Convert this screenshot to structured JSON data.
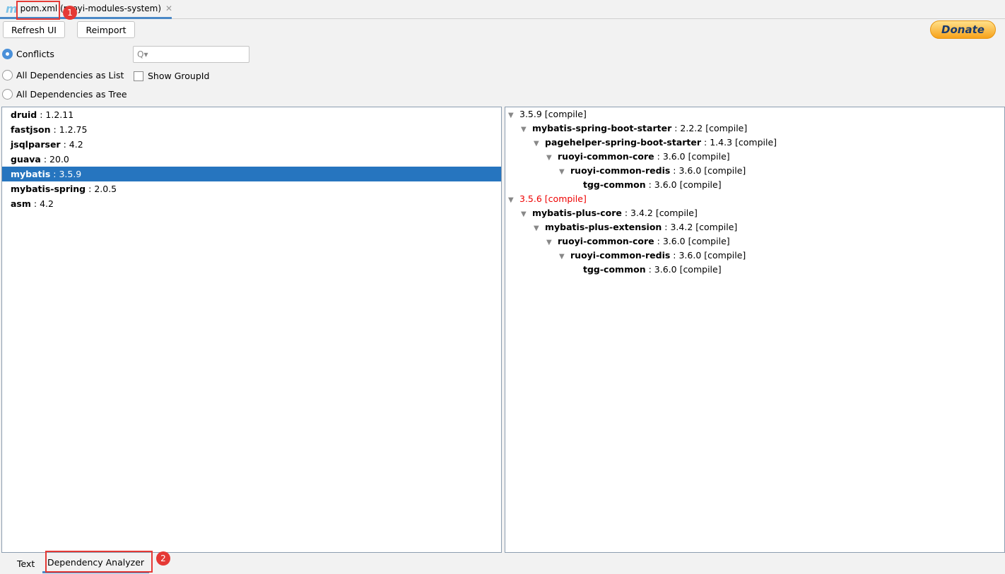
{
  "editor_tab": {
    "icon": "maven-icon",
    "icon_glyph": "m",
    "file": "pom.xml",
    "module": "(ruoyi-modules-system)"
  },
  "annotations": {
    "badge1": "1",
    "badge2": "2"
  },
  "toolbar": {
    "refresh": "Refresh UI",
    "reimport": "Reimport",
    "donate": "Donate"
  },
  "modes": [
    {
      "label": "Conflicts",
      "selected": true
    },
    {
      "label": "All Dependencies as List",
      "selected": false
    },
    {
      "label": "All Dependencies as Tree",
      "selected": false
    }
  ],
  "search": {
    "placeholder": "Q▾",
    "value": ""
  },
  "show_group_id": {
    "label": "Show GroupId",
    "checked": false
  },
  "conflicts": [
    {
      "name": "druid",
      "version": "1.2.11"
    },
    {
      "name": "fastjson",
      "version": "1.2.75"
    },
    {
      "name": "jsqlparser",
      "version": "4.2"
    },
    {
      "name": "guava",
      "version": "20.0"
    },
    {
      "name": "mybatis",
      "version": "3.5.9",
      "selected": true
    },
    {
      "name": "mybatis-spring",
      "version": "2.0.5"
    },
    {
      "name": "asm",
      "version": "4.2"
    }
  ],
  "tree": [
    {
      "level": 0,
      "name": "",
      "version": "3.5.9",
      "scope": "[compile]",
      "expanded": true,
      "conflict": false
    },
    {
      "level": 1,
      "name": "mybatis-spring-boot-starter",
      "version": "2.2.2",
      "scope": "[compile]",
      "expanded": true
    },
    {
      "level": 2,
      "name": "pagehelper-spring-boot-starter",
      "version": "1.4.3",
      "scope": "[compile]",
      "expanded": true
    },
    {
      "level": 3,
      "name": "ruoyi-common-core",
      "version": "3.6.0",
      "scope": "[compile]",
      "expanded": true
    },
    {
      "level": 4,
      "name": "ruoyi-common-redis",
      "version": "3.6.0",
      "scope": "[compile]",
      "expanded": true
    },
    {
      "level": 5,
      "name": "tgg-common",
      "version": "3.6.0",
      "scope": "[compile]",
      "leaf": true
    },
    {
      "level": 0,
      "name": "",
      "version": "3.5.6",
      "scope": "[compile]",
      "expanded": true,
      "conflict": true
    },
    {
      "level": 1,
      "name": "mybatis-plus-core",
      "version": "3.4.2",
      "scope": "[compile]",
      "expanded": true
    },
    {
      "level": 2,
      "name": "mybatis-plus-extension",
      "version": "3.4.2",
      "scope": "[compile]",
      "expanded": true
    },
    {
      "level": 3,
      "name": "ruoyi-common-core",
      "version": "3.6.0",
      "scope": "[compile]",
      "expanded": true
    },
    {
      "level": 4,
      "name": "ruoyi-common-redis",
      "version": "3.6.0",
      "scope": "[compile]",
      "expanded": true
    },
    {
      "level": 5,
      "name": "tgg-common",
      "version": "3.6.0",
      "scope": "[compile]",
      "leaf": true
    }
  ],
  "bottom_tabs": [
    {
      "label": "Text",
      "active": false
    },
    {
      "label": "Dependency Analyzer",
      "active": true
    }
  ],
  "colors": {
    "selection": "#2675bf",
    "conflict": "#ee0000",
    "annotation": "#e53935",
    "accent": "#4a88c7"
  }
}
